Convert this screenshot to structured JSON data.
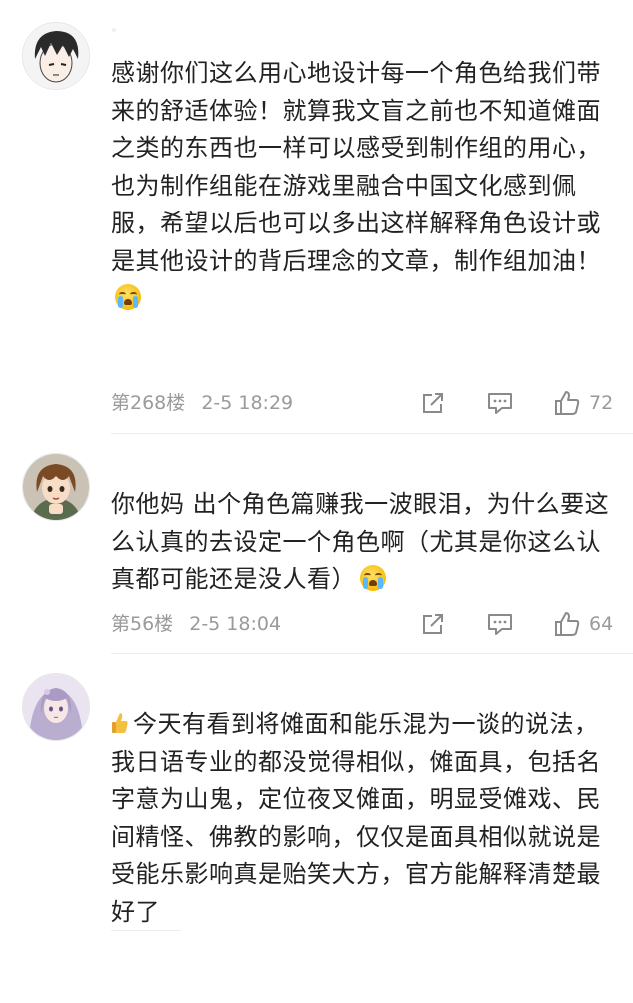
{
  "comments": [
    {
      "avatar": "avatar-boy-dark-hair",
      "text": "感谢你们这么用心地设计每一个角色给我们带来的舒适体验！就算我文盲之前也不知道傩面之类的东西也一样可以感受到制作组的用心，也为制作组能在游戏里融合中国文化感到佩服，希望以后也可以多出这样解释角色设计或是其他设计的背后理念的文章，制作组加油！",
      "emoji": "loudly-crying-face",
      "floor": "第268楼",
      "time": "2-5 18:29",
      "likes": "72"
    },
    {
      "avatar": "avatar-anime-brown-hair",
      "text": "你他妈 出个角色篇赚我一波眼泪，为什么要这么认真的去设定一个角色啊（尤其是你这么认真都可能还是没人看）",
      "emoji": "loudly-crying-face",
      "floor": "第56楼",
      "time": "2-5 18:04",
      "likes": "64"
    },
    {
      "avatar": "avatar-anime-silver-hair",
      "lead_emoji": "thumbs-up",
      "text": "今天有看到将傩面和能乐混为一谈的说法，我日语专业的都没觉得相似，傩面具，包括名字意为山鬼，定位夜叉傩面，明显受傩戏、民间精怪、佛教的影响，仅仅是面具相似就说是受能乐影响真是贻笑大方，官方能解释清楚最好了"
    }
  ],
  "icons": {
    "share": "share-icon",
    "reply": "comment-icon",
    "like": "thumbs-up-icon"
  },
  "colors": {
    "text": "#222222",
    "meta": "#9a9a9a",
    "icon": "#8a8a8a",
    "divider": "#ececec"
  }
}
